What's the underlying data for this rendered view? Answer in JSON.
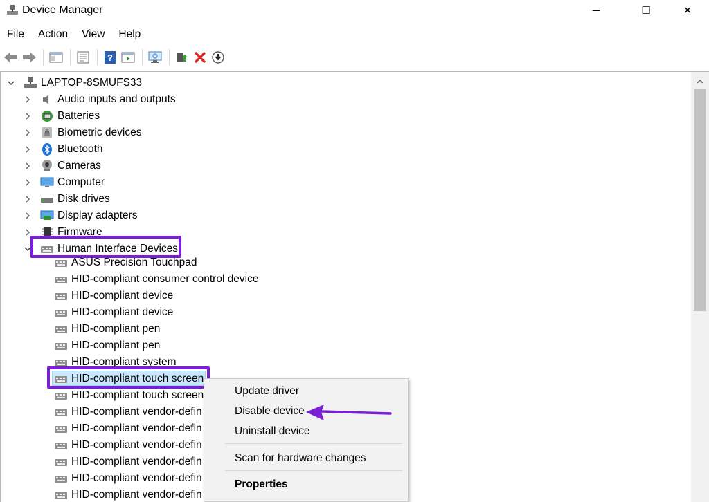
{
  "window": {
    "title": "Device Manager",
    "controls": {
      "minimize": "─",
      "maximize": "☐",
      "close": "✕"
    }
  },
  "menu": [
    "File",
    "Action",
    "View",
    "Help"
  ],
  "toolbar": {
    "buttons": [
      "back-icon",
      "forward-icon",
      "show-hide-console-tree-icon",
      "properties-icon",
      "help-icon",
      "show-action-pane-icon",
      "scan-hardware-icon",
      "update-driver-icon",
      "uninstall-icon",
      "download-icon"
    ]
  },
  "tree": {
    "root": "LAPTOP-8SMUFS33",
    "categories": [
      "Audio inputs and outputs",
      "Batteries",
      "Biometric devices",
      "Bluetooth",
      "Cameras",
      "Computer",
      "Disk drives",
      "Display adapters",
      "Firmware",
      "Human Interface Devices"
    ],
    "hid_children": [
      "ASUS Precision Touchpad",
      "HID-compliant consumer control device",
      "HID-compliant device",
      "HID-compliant device",
      "HID-compliant pen",
      "HID-compliant pen",
      "HID-compliant system",
      "HID-compliant touch screen",
      "HID-compliant touch screen",
      "HID-compliant vendor-defin",
      "HID-compliant vendor-defin",
      "HID-compliant vendor-defin",
      "HID-compliant vendor-defin",
      "HID-compliant vendor-defin",
      "HID-compliant vendor-defin"
    ]
  },
  "context_menu": {
    "update_driver": "Update driver",
    "disable_device": "Disable device",
    "uninstall_device": "Uninstall device",
    "scan_hardware": "Scan for hardware changes",
    "properties": "Properties"
  },
  "colors": {
    "annotation": "#7a1fd6",
    "selection": "#cce8ff",
    "menu_bg": "#f2f2f2"
  }
}
